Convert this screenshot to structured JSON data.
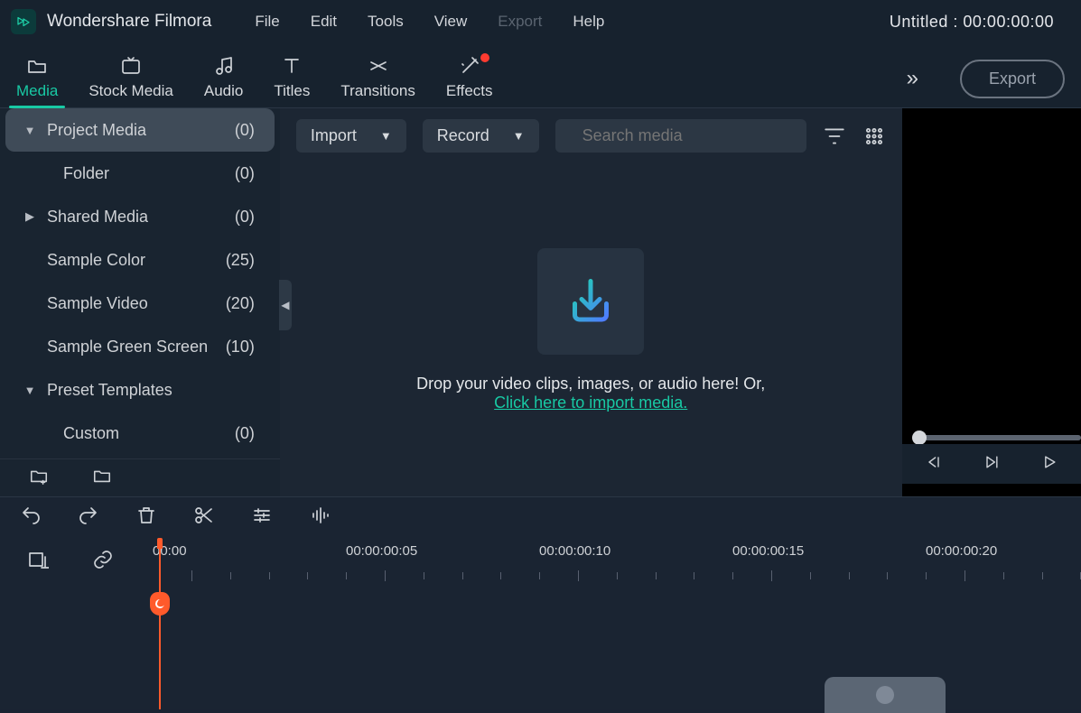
{
  "app_name": "Wondershare Filmora",
  "menu": [
    "File",
    "Edit",
    "Tools",
    "View",
    "Export",
    "Help"
  ],
  "menu_disabled_index": 4,
  "doc_title": "Untitled : 00:00:00:00",
  "tooltabs": [
    {
      "id": "media",
      "label": "Media",
      "icon": "folder"
    },
    {
      "id": "stock",
      "label": "Stock Media",
      "icon": "stock"
    },
    {
      "id": "audio",
      "label": "Audio",
      "icon": "music"
    },
    {
      "id": "titles",
      "label": "Titles",
      "icon": "text"
    },
    {
      "id": "transitions",
      "label": "Transitions",
      "icon": "transition"
    },
    {
      "id": "effects",
      "label": "Effects",
      "icon": "magic",
      "dot": true
    }
  ],
  "active_tab": "media",
  "export_label": "Export",
  "sidebar": [
    {
      "label": "Project Media",
      "count": "(0)",
      "arrow": "down",
      "selected": true
    },
    {
      "label": "Folder",
      "count": "(0)",
      "child": true
    },
    {
      "label": "Shared Media",
      "count": "(0)",
      "arrow": "right"
    },
    {
      "label": "Sample Color",
      "count": "(25)"
    },
    {
      "label": "Sample Video",
      "count": "(20)"
    },
    {
      "label": "Sample Green Screen",
      "count": "(10)"
    },
    {
      "label": "Preset Templates",
      "count": "",
      "arrow": "down"
    },
    {
      "label": "Custom",
      "count": "(0)",
      "child": true
    }
  ],
  "media_bar": {
    "import": "Import",
    "record": "Record",
    "search_placeholder": "Search media"
  },
  "drop": {
    "text": "Drop your video clips, images, or audio here! Or,",
    "link": "Click here to import media."
  },
  "timecodes": [
    "00:00",
    "00:00:00:05",
    "00:00:00:10",
    "00:00:00:15",
    "00:00:00:20"
  ]
}
